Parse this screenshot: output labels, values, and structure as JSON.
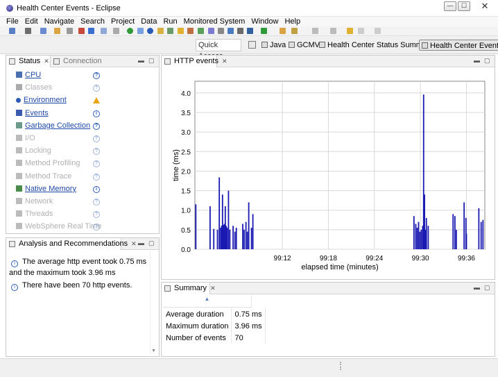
{
  "window": {
    "title": "Health Center Events - Eclipse",
    "min": "—",
    "max": "☐",
    "close": "✕"
  },
  "menu": [
    "File",
    "Edit",
    "Navigate",
    "Search",
    "Project",
    "Data",
    "Run",
    "Monitored System",
    "Window",
    "Help"
  ],
  "toolbar": {
    "quick_access_placeholder": "Quick Access"
  },
  "perspectives": [
    "Java",
    "GCMV",
    "Health Center Status Summary",
    "Health Center Events"
  ],
  "status_view": {
    "tabs": [
      {
        "label": "Status",
        "active": true
      },
      {
        "label": "Connection",
        "active": false
      }
    ],
    "items": [
      {
        "label": "CPU",
        "enabled": true,
        "status": "info-circle",
        "icon": "monitor"
      },
      {
        "label": "Classes",
        "enabled": false,
        "status": "info-circle",
        "icon": "gear"
      },
      {
        "label": "Environment",
        "enabled": true,
        "status": "warning",
        "icon": "dot"
      },
      {
        "label": "Events",
        "enabled": true,
        "status": "info",
        "icon": "events"
      },
      {
        "label": "Garbage Collection",
        "enabled": true,
        "status": "info-circle",
        "icon": "trash"
      },
      {
        "label": "I/O",
        "enabled": false,
        "status": "info-circle",
        "icon": "io"
      },
      {
        "label": "Locking",
        "enabled": false,
        "status": "info-circle",
        "icon": "lock"
      },
      {
        "label": "Method Profiling",
        "enabled": false,
        "status": "info-circle",
        "icon": "profile"
      },
      {
        "label": "Method Trace",
        "enabled": false,
        "status": "info-circle",
        "icon": "trace"
      },
      {
        "label": "Native Memory",
        "enabled": true,
        "status": "info",
        "icon": "memory"
      },
      {
        "label": "Network",
        "enabled": false,
        "status": "info-circle",
        "icon": "network"
      },
      {
        "label": "Threads",
        "enabled": false,
        "status": "info-circle",
        "icon": "threads"
      },
      {
        "label": "WebSphere Real Time",
        "enabled": false,
        "status": "info-circle",
        "icon": "websphere"
      }
    ]
  },
  "analysis_view": {
    "title": "Analysis and Recommendations",
    "messages": [
      "The average http event took 0.75 ms and the maximum took 3.96 ms",
      "There have been 70 http events."
    ]
  },
  "chart_view": {
    "title": "HTTP events"
  },
  "chart_data": {
    "type": "bar",
    "xlabel": "elapsed time (minutes)",
    "ylabel": "time (ms)",
    "ylim": [
      0,
      4.3
    ],
    "xlim": [
      99.01,
      99.64
    ],
    "yticks": [
      "0.0",
      "0.5",
      "1.0",
      "1.5",
      "2.0",
      "2.5",
      "3.0",
      "3.5",
      "4.0"
    ],
    "xticks": [
      "99:12",
      "99:18",
      "99:24",
      "99:30",
      "99:36"
    ],
    "xtick_values": [
      99.2,
      99.3,
      99.4,
      99.5,
      99.6
    ],
    "grid": true,
    "color": "#1a1ab3",
    "series": [
      {
        "x": [
          99.012,
          99.043,
          99.051,
          99.059,
          99.063,
          99.066,
          99.068,
          99.07,
          99.072,
          99.074,
          99.076,
          99.078,
          99.08,
          99.083,
          99.086,
          99.093,
          99.097,
          99.1,
          99.114,
          99.117,
          99.121,
          99.124,
          99.127,
          99.133,
          99.136,
          99.486,
          99.49,
          99.493,
          99.496,
          99.499,
          99.502,
          99.505,
          99.507,
          99.509,
          99.511,
          99.513,
          99.517,
          99.571,
          99.575,
          99.578,
          99.595,
          99.599,
          99.6,
          99.627,
          99.632,
          99.636
        ],
        "y": [
          1.15,
          1.1,
          0.52,
          0.5,
          1.84,
          0.55,
          0.6,
          1.4,
          0.62,
          0.65,
          1.1,
          0.6,
          0.55,
          1.5,
          0.5,
          0.6,
          0.45,
          0.55,
          0.65,
          0.5,
          0.7,
          0.45,
          1.2,
          0.55,
          0.9,
          0.85,
          0.65,
          0.55,
          0.7,
          0.45,
          0.5,
          0.6,
          3.96,
          1.4,
          0.5,
          0.8,
          0.6,
          0.9,
          0.85,
          0.5,
          1.2,
          0.8,
          0.4,
          1.05,
          0.7,
          0.75
        ]
      }
    ]
  },
  "summary_view": {
    "title": "Summary",
    "rows": [
      {
        "label": "Average duration",
        "value": "0.75 ms"
      },
      {
        "label": "Maximum duration",
        "value": "3.96 ms"
      },
      {
        "label": "Number of events",
        "value": "70"
      }
    ]
  }
}
